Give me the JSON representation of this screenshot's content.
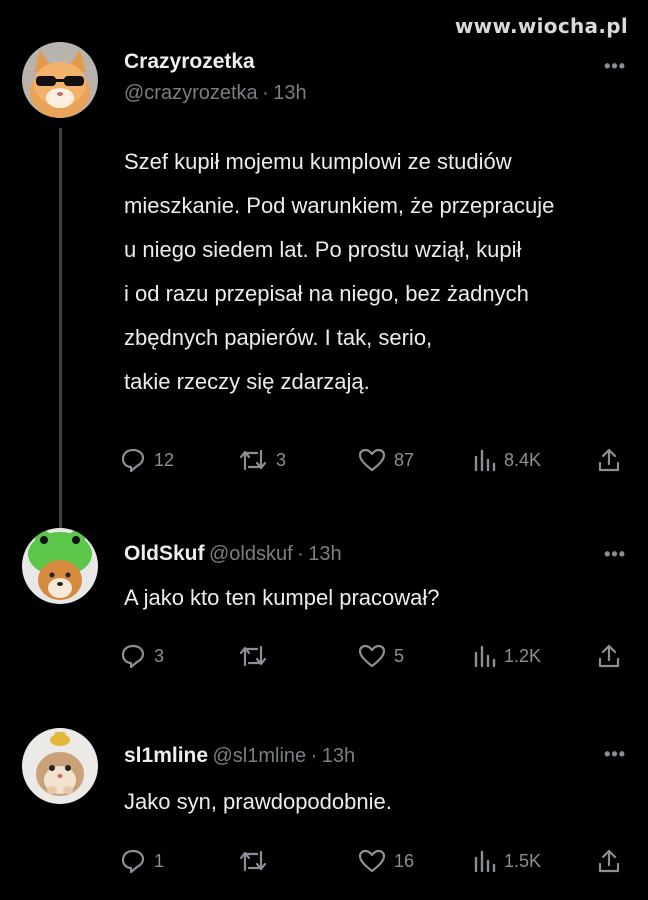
{
  "site_watermark": "www.wiocha.pl",
  "tweets": [
    {
      "name": "Crazyrozetka",
      "handle": "@crazyrozetka",
      "separator": "·",
      "time": "13h",
      "more_label": "•••",
      "lines": [
        "Szef kupił mojemu kumplowi ze studiów",
        "mieszkanie. Pod warunkiem, że przepracuje",
        "u niego siedem lat. Po prostu wziął, kupił",
        "i od razu przepisał na niego, bez żadnych",
        "zbędnych papierów. I tak, serio,",
        "takie rzeczy się zdarzają."
      ],
      "replies": "12",
      "retweets": "3",
      "likes": "87",
      "views": "8.4K",
      "avatar_icon": "cat-with-sunglasses-avatar"
    },
    {
      "name": "OldSkuf",
      "handle": "@oldskuf",
      "separator": "·",
      "time": "13h",
      "more_label": "•••",
      "lines": [
        "A jako kto ten kumpel pracował?"
      ],
      "replies": "3",
      "retweets": "",
      "likes": "5",
      "views": "1.2K",
      "avatar_icon": "shiba-in-frog-hat-avatar"
    },
    {
      "name": "sl1mline",
      "handle": "@sl1mline",
      "separator": "·",
      "time": "13h",
      "more_label": "•••",
      "lines": [
        "Jako syn, prawdopodobnie."
      ],
      "replies": "1",
      "retweets": "",
      "likes": "16",
      "views": "1.5K",
      "avatar_icon": "hamster-with-hat-avatar"
    }
  ],
  "colors": {
    "background": "#000000",
    "text": "#e7e9ea",
    "muted": "#7a7f84",
    "thread_line": "#3b3f43"
  }
}
